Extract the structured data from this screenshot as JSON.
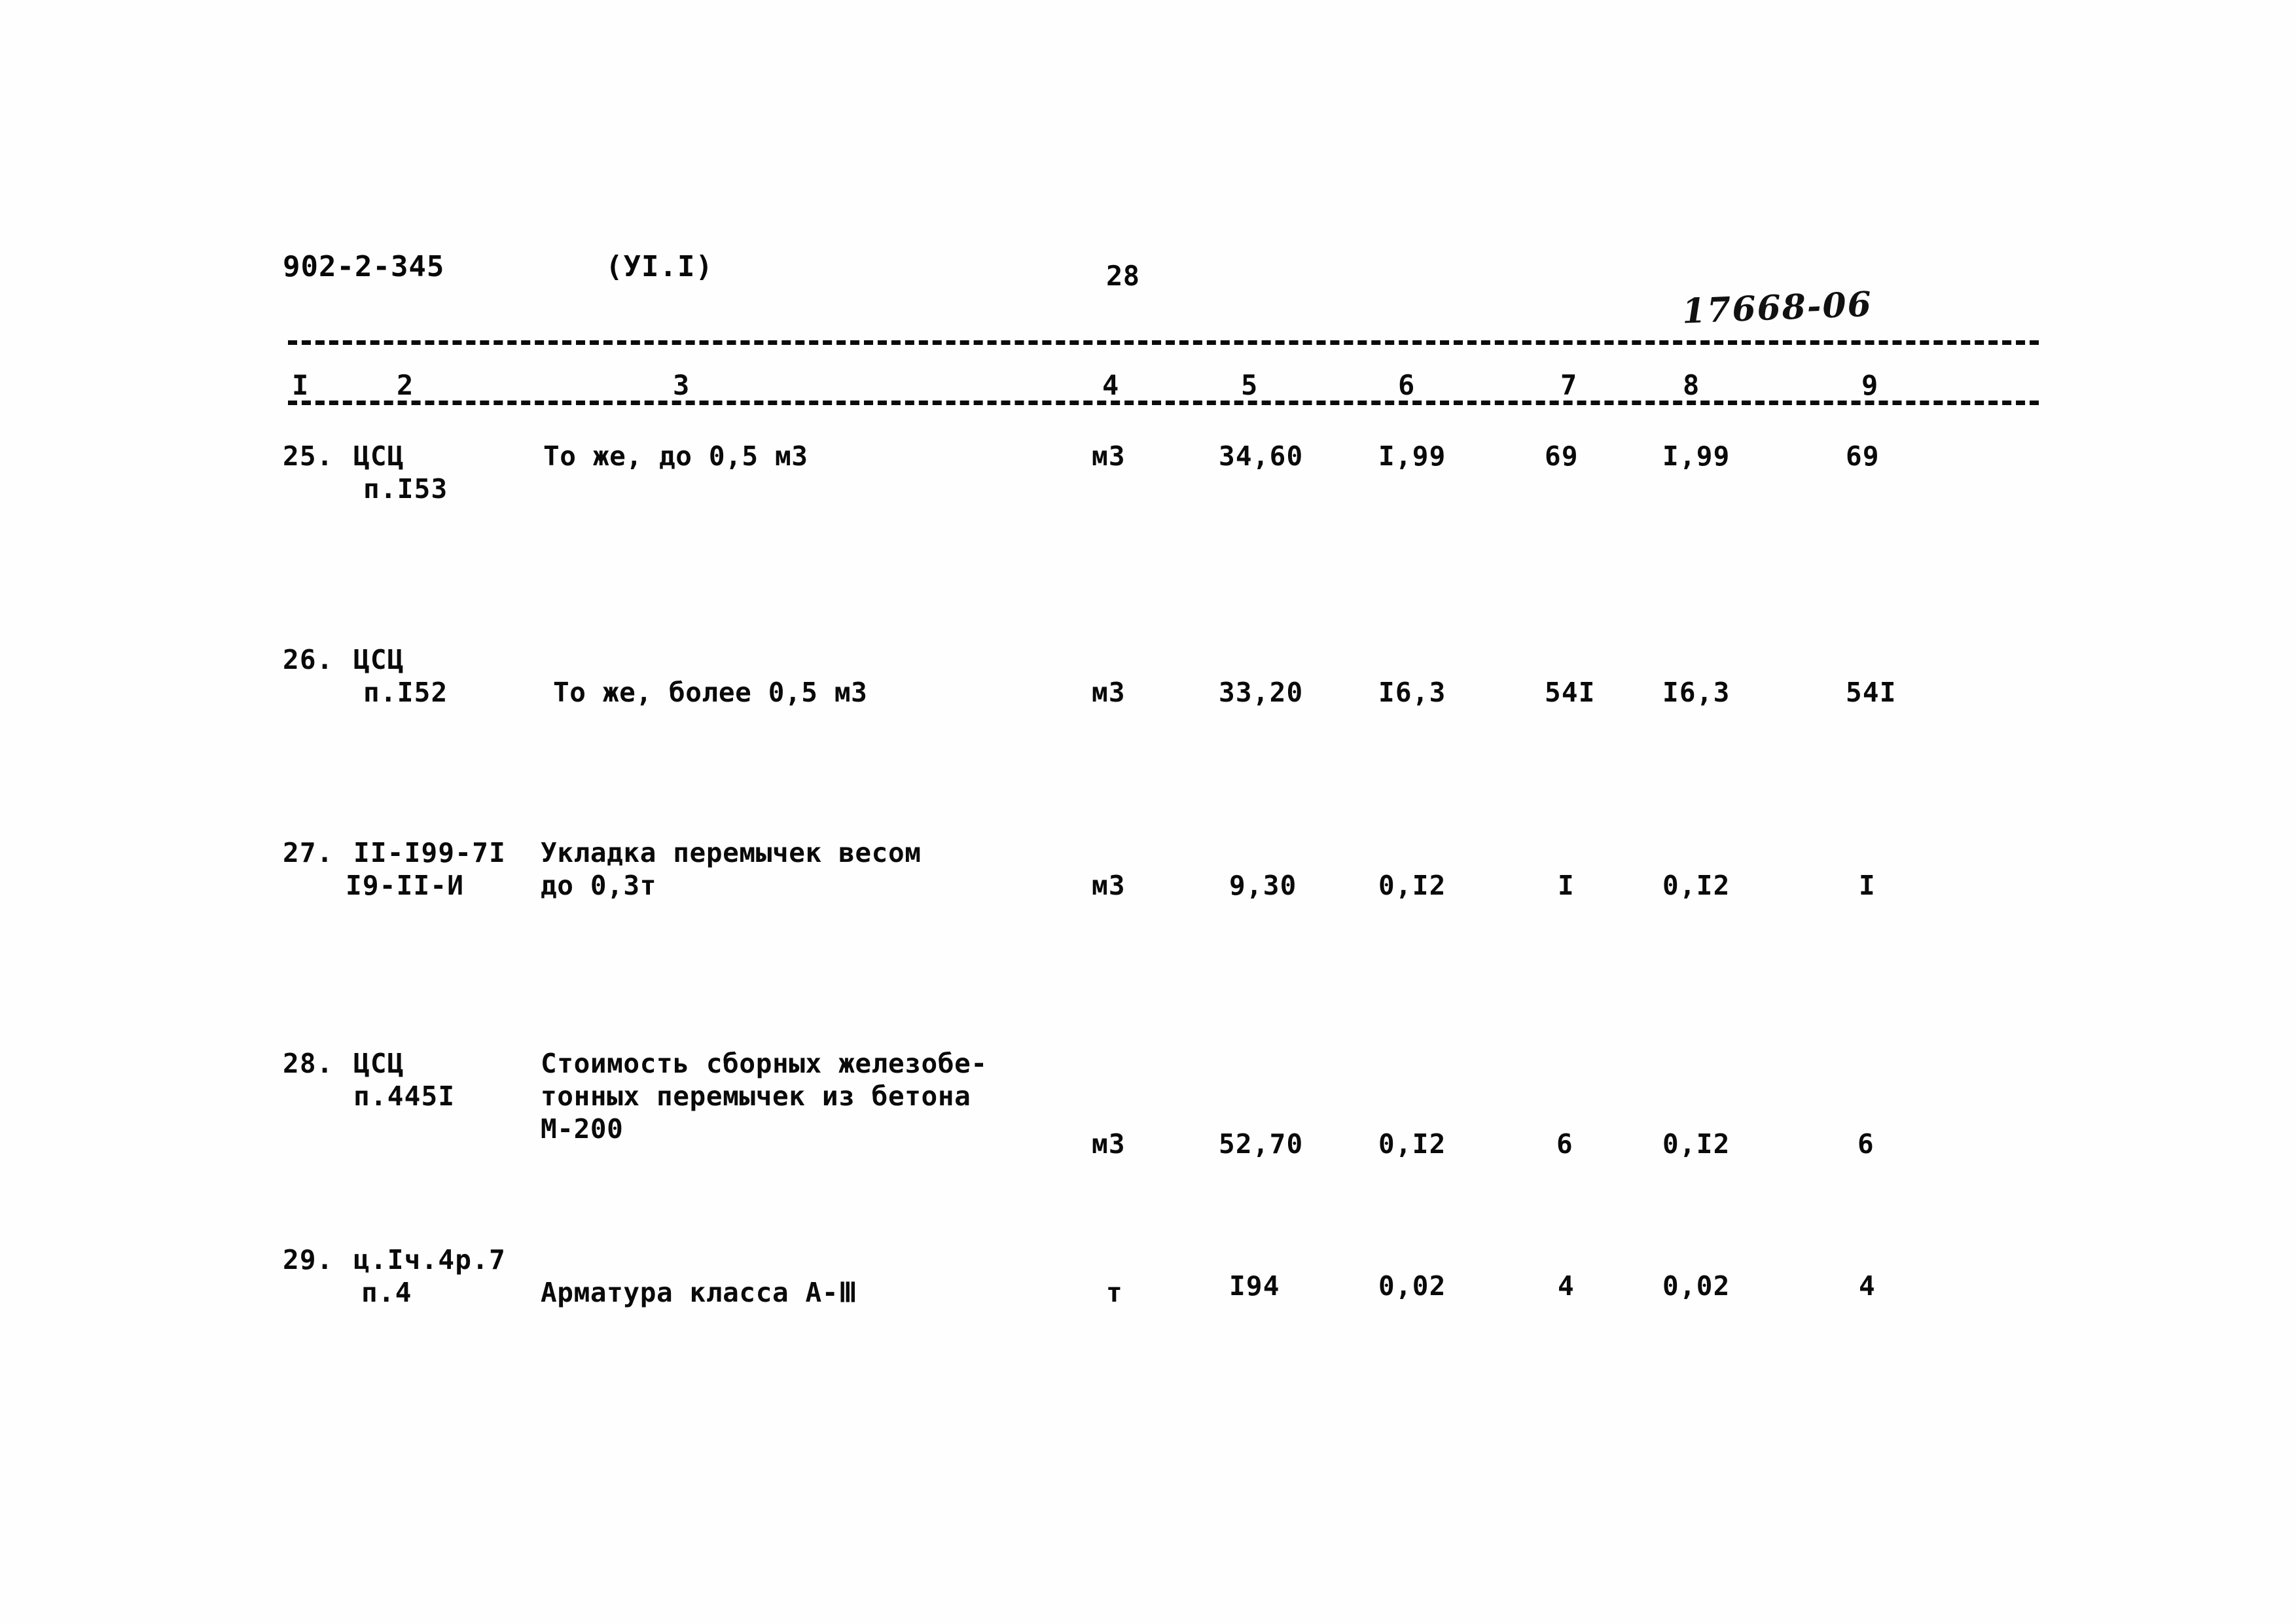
{
  "header": {
    "doc_code": "902-2-345",
    "part_code": "(УI.I)",
    "page_number": "28",
    "archive_stamp": "17668-06"
  },
  "table": {
    "column_headers": [
      "I",
      "2",
      "3",
      "4",
      "5",
      "6",
      "7",
      "8",
      "9"
    ],
    "rows": [
      {
        "no": "25.",
        "code_line1": "ЦСЦ",
        "code_line2": "п.I53",
        "desc_line1": "То же, до 0,5 м3",
        "desc_line2": "",
        "desc_line3": "",
        "unit": "м3",
        "col5": "34,60",
        "col6": "I,99",
        "col7": "69",
        "col8": "I,99",
        "col9": "69"
      },
      {
        "no": "26.",
        "code_line1": "ЦСЦ",
        "code_line2": "п.I52",
        "desc_line1": "То же, более 0,5 м3",
        "desc_line2": "",
        "desc_line3": "",
        "unit": "м3",
        "col5": "33,20",
        "col6": "I6,3",
        "col7": "54I",
        "col8": "I6,3",
        "col9": "54I"
      },
      {
        "no": "27.",
        "code_line1": "II-I99-7I",
        "code_line2": "I9-II-И",
        "desc_line1": "Укладка перемычек весом",
        "desc_line2": "до 0,3т",
        "desc_line3": "",
        "unit": "м3",
        "col5": "9,30",
        "col6": "0,I2",
        "col7": "I",
        "col8": "0,I2",
        "col9": "I"
      },
      {
        "no": "28.",
        "code_line1": "ЦСЦ",
        "code_line2": "п.445I",
        "desc_line1": "Стоимость сборных железобе-",
        "desc_line2": "тонных перемычек из бетона",
        "desc_line3": "М-200",
        "unit": "м3",
        "col5": "52,70",
        "col6": "0,I2",
        "col7": "6",
        "col8": "0,I2",
        "col9": "6"
      },
      {
        "no": "29.",
        "code_line1": "ц.Iч.4р.7",
        "code_line2": "п.4",
        "desc_line1": "Арматура класса А-Ⅲ",
        "desc_line2": "",
        "desc_line3": "",
        "unit": "т",
        "col5": "I94",
        "col6": "0,02",
        "col7": "4",
        "col8": "0,02",
        "col9": "4"
      }
    ]
  }
}
